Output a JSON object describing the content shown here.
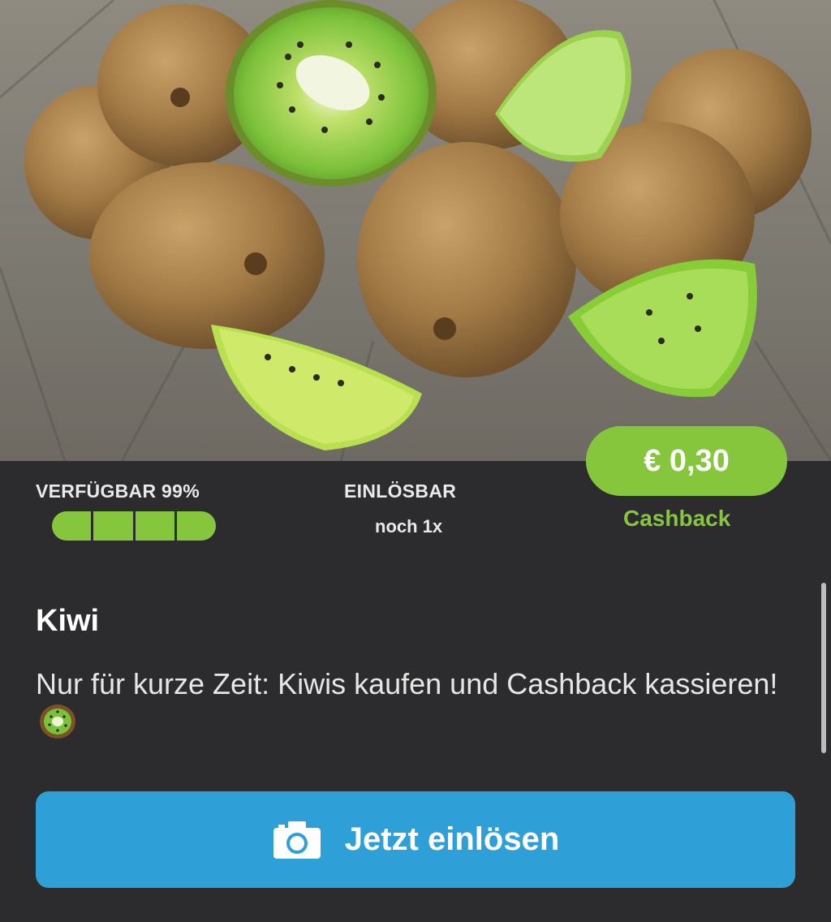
{
  "offer": {
    "image_alt": "kiwi-photo",
    "price": "€ 0,30",
    "price_caption": "Cashback",
    "availability_label": "VERFÜGBAR 99%",
    "availability_fraction": 0.99,
    "redeemable_label": "EINLÖSBAR",
    "redeemable_count": "noch 1x",
    "title": "Kiwi",
    "description": "Nur für kurze Zeit: Kiwis kaufen und Cashback kassieren!",
    "description_emoji": "kiwi-fruit-emoji"
  },
  "cta": {
    "label": "Jetzt einlösen",
    "icon": "camera-icon"
  },
  "colors": {
    "accent_green": "#86c63d",
    "cta_blue": "#2f9fd8",
    "panel_bg": "#2c2c2e"
  }
}
